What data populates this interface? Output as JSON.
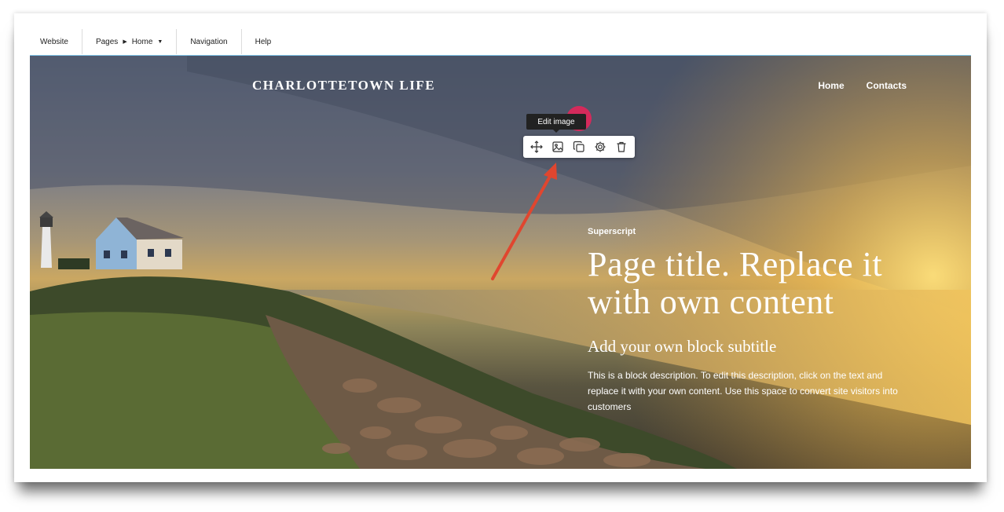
{
  "topbar": {
    "website": "Website",
    "pages": "Pages",
    "home": "Home",
    "navigation": "Navigation",
    "help": "Help"
  },
  "site": {
    "title": "CHARLOTTETOWN LIFE",
    "nav": [
      "Home",
      "Contacts"
    ]
  },
  "editor": {
    "tooltip": "Edit image",
    "tools": [
      "move-icon",
      "image-icon",
      "duplicate-icon",
      "settings-icon",
      "trash-icon"
    ]
  },
  "hero": {
    "superscript": "Superscript",
    "title": "Page title. Replace it with own content",
    "subtitle": "Add your own block subtitle",
    "description": "This is a block description. To edit this description, click on the text and replace it with your own content. Use this space to convert site visitors into customers"
  },
  "colors": {
    "annotation_arrow": "#e0462f",
    "highlight_dot": "#d42a5b",
    "accent_border": "#7fc4e8"
  }
}
